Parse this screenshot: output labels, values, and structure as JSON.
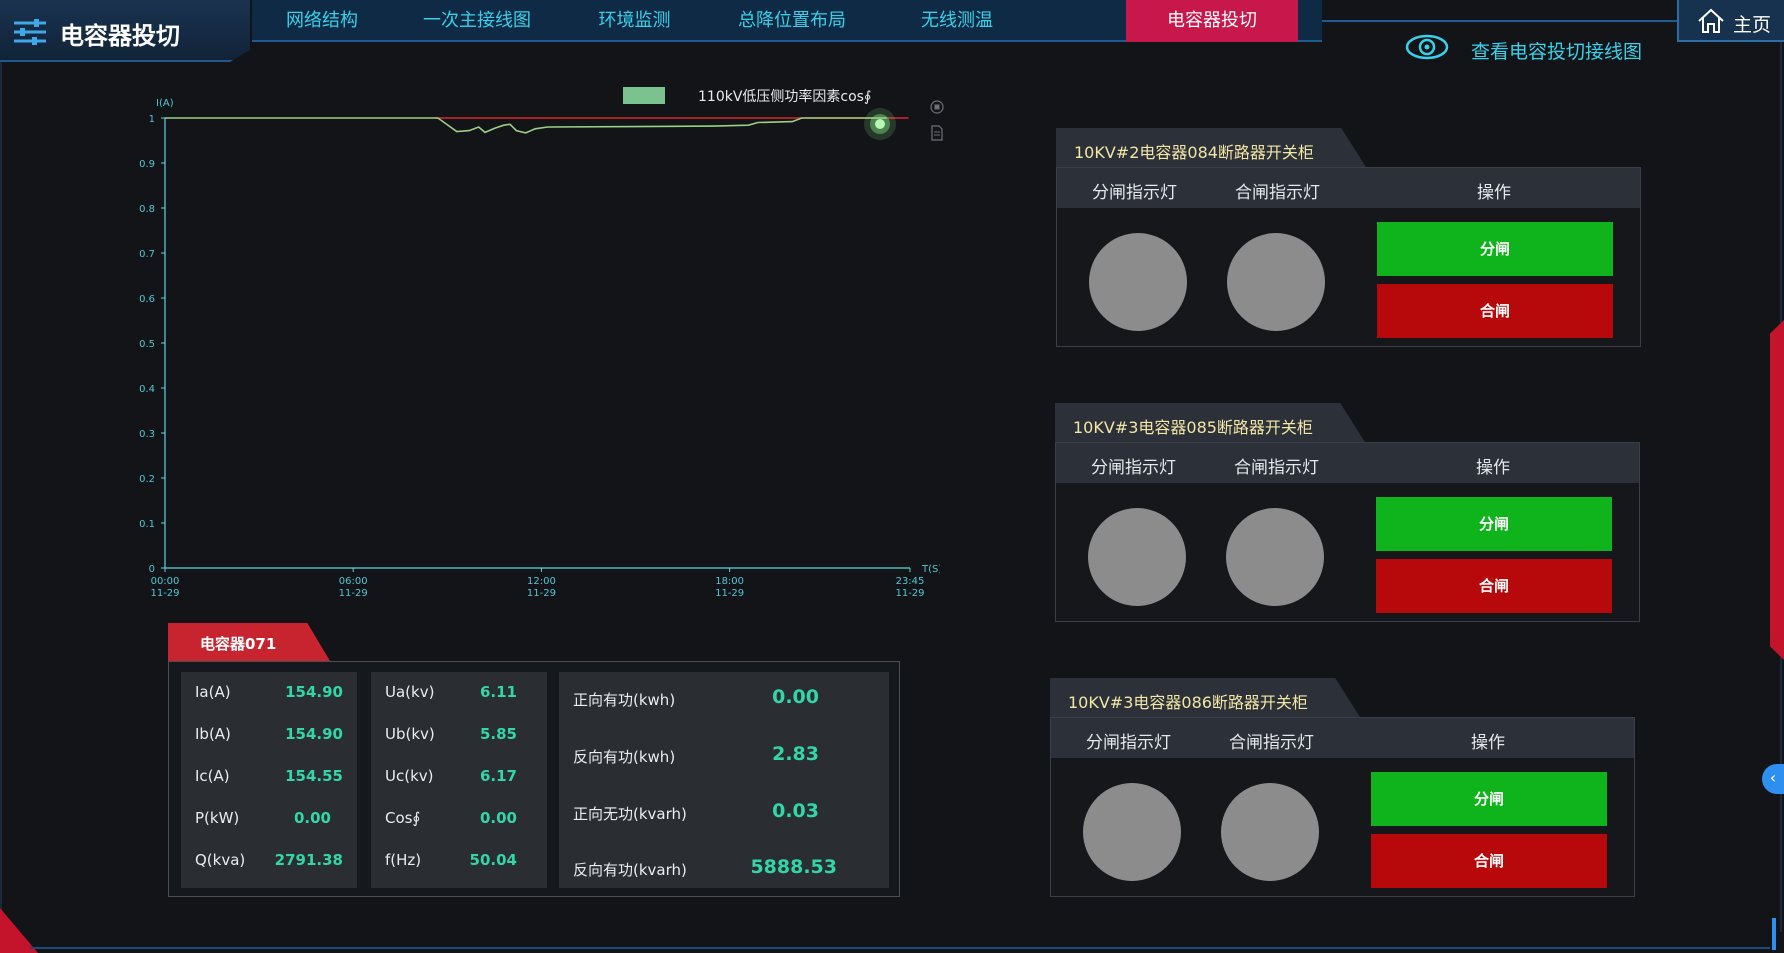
{
  "app": {
    "title": "电容器投切"
  },
  "nav": {
    "tabs": [
      {
        "label": "网络结构"
      },
      {
        "label": "一次主接线图"
      },
      {
        "label": "环境监测"
      },
      {
        "label": "总降位置布局"
      },
      {
        "label": "无线测温"
      },
      {
        "label": "电容器投切",
        "active": true
      }
    ]
  },
  "home": {
    "label": "主页"
  },
  "view_link": {
    "label": "查看电容投切接线图"
  },
  "chart_data": {
    "type": "line",
    "legend": [
      "110kV低压侧功率因素cos∮"
    ],
    "ylabel": "I(A)",
    "xlabel": "T(S)",
    "ylim": [
      0,
      1
    ],
    "yticks": [
      "0",
      "0.1",
      "0.2",
      "0.3",
      "0.4",
      "0.5",
      "0.6",
      "0.7",
      "0.8",
      "0.9",
      "1"
    ],
    "xticks": [
      {
        "time": "00:00",
        "date": "11-29"
      },
      {
        "time": "06:00",
        "date": "11-29"
      },
      {
        "time": "12:00",
        "date": "11-29"
      },
      {
        "time": "18:00",
        "date": "11-29"
      },
      {
        "time": "23:45",
        "date": "11-29"
      }
    ],
    "xrange_hours": [
      0,
      23.75
    ],
    "series": [
      {
        "name": "110kV低压侧功率因素cos∮",
        "color": "#9bcf85",
        "points": [
          [
            0,
            1.0
          ],
          [
            8.7,
            1.0
          ],
          [
            9.0,
            0.985
          ],
          [
            9.3,
            0.97
          ],
          [
            9.7,
            0.972
          ],
          [
            10.0,
            0.98
          ],
          [
            10.2,
            0.968
          ],
          [
            10.5,
            0.977
          ],
          [
            10.8,
            0.984
          ],
          [
            11.0,
            0.986
          ],
          [
            11.2,
            0.972
          ],
          [
            11.5,
            0.967
          ],
          [
            11.8,
            0.976
          ],
          [
            12.2,
            0.98
          ],
          [
            15.0,
            0.981
          ],
          [
            17.5,
            0.982
          ],
          [
            18.6,
            0.984
          ],
          [
            18.9,
            0.99
          ],
          [
            20.0,
            0.992
          ],
          [
            20.3,
            1.0
          ],
          [
            23.0,
            1.0
          ]
        ]
      },
      {
        "name": "",
        "color": "#d52a2a",
        "points": [
          [
            8.6,
            1.0
          ],
          [
            23.7,
            1.0
          ]
        ]
      }
    ]
  },
  "capacitor": {
    "tag": "电容器071",
    "col1": [
      {
        "k": "Ia(A)",
        "v": "154.90"
      },
      {
        "k": "Ib(A)",
        "v": "154.90"
      },
      {
        "k": "Ic(A)",
        "v": "154.55"
      },
      {
        "k": "P(kW)",
        "v": "0.00"
      },
      {
        "k": "Q(kva)",
        "v": "2791.38"
      }
    ],
    "col2": [
      {
        "k": "Ua(kv)",
        "v": "6.11"
      },
      {
        "k": "Ub(kv)",
        "v": "5.85"
      },
      {
        "k": "Uc(kv)",
        "v": "6.17"
      },
      {
        "k": "Cos∮",
        "v": "0.00"
      },
      {
        "k": "f(Hz)",
        "v": "50.04"
      }
    ],
    "col3": [
      {
        "k": "正向有功(kwh)",
        "v": "0.00"
      },
      {
        "k": "反向有功(kwh)",
        "v": "2.83"
      },
      {
        "k": "正向无功(kvarh)",
        "v": "0.03"
      },
      {
        "k": "反向有功(kvarh)",
        "v": "5888.53"
      }
    ]
  },
  "cabinets": [
    {
      "title": "10KV#2电容器084断路器开关柜",
      "h_open": "分闸指示灯",
      "h_close": "合闸指示灯",
      "h_op": "操作",
      "btn_open": "分闸",
      "btn_close": "合闸"
    },
    {
      "title": "10KV#3电容器085断路器开关柜",
      "h_open": "分闸指示灯",
      "h_close": "合闸指示灯",
      "h_op": "操作",
      "btn_open": "分闸",
      "btn_close": "合闸"
    },
    {
      "title": "10KV#3电容器086断路器开关柜",
      "h_open": "分闸指示灯",
      "h_close": "合闸指示灯",
      "h_op": "操作",
      "btn_open": "分闸",
      "btn_close": "合闸"
    }
  ],
  "side_handle": {
    "label": "‹"
  },
  "colors": {
    "accent_cyan": "#36d0ea",
    "accent_red": "#c8174a",
    "value_green": "#32d6a8",
    "btn_green": "#0fb31b",
    "btn_red": "#b7090b",
    "lamp_gray": "#8c8c8c"
  }
}
